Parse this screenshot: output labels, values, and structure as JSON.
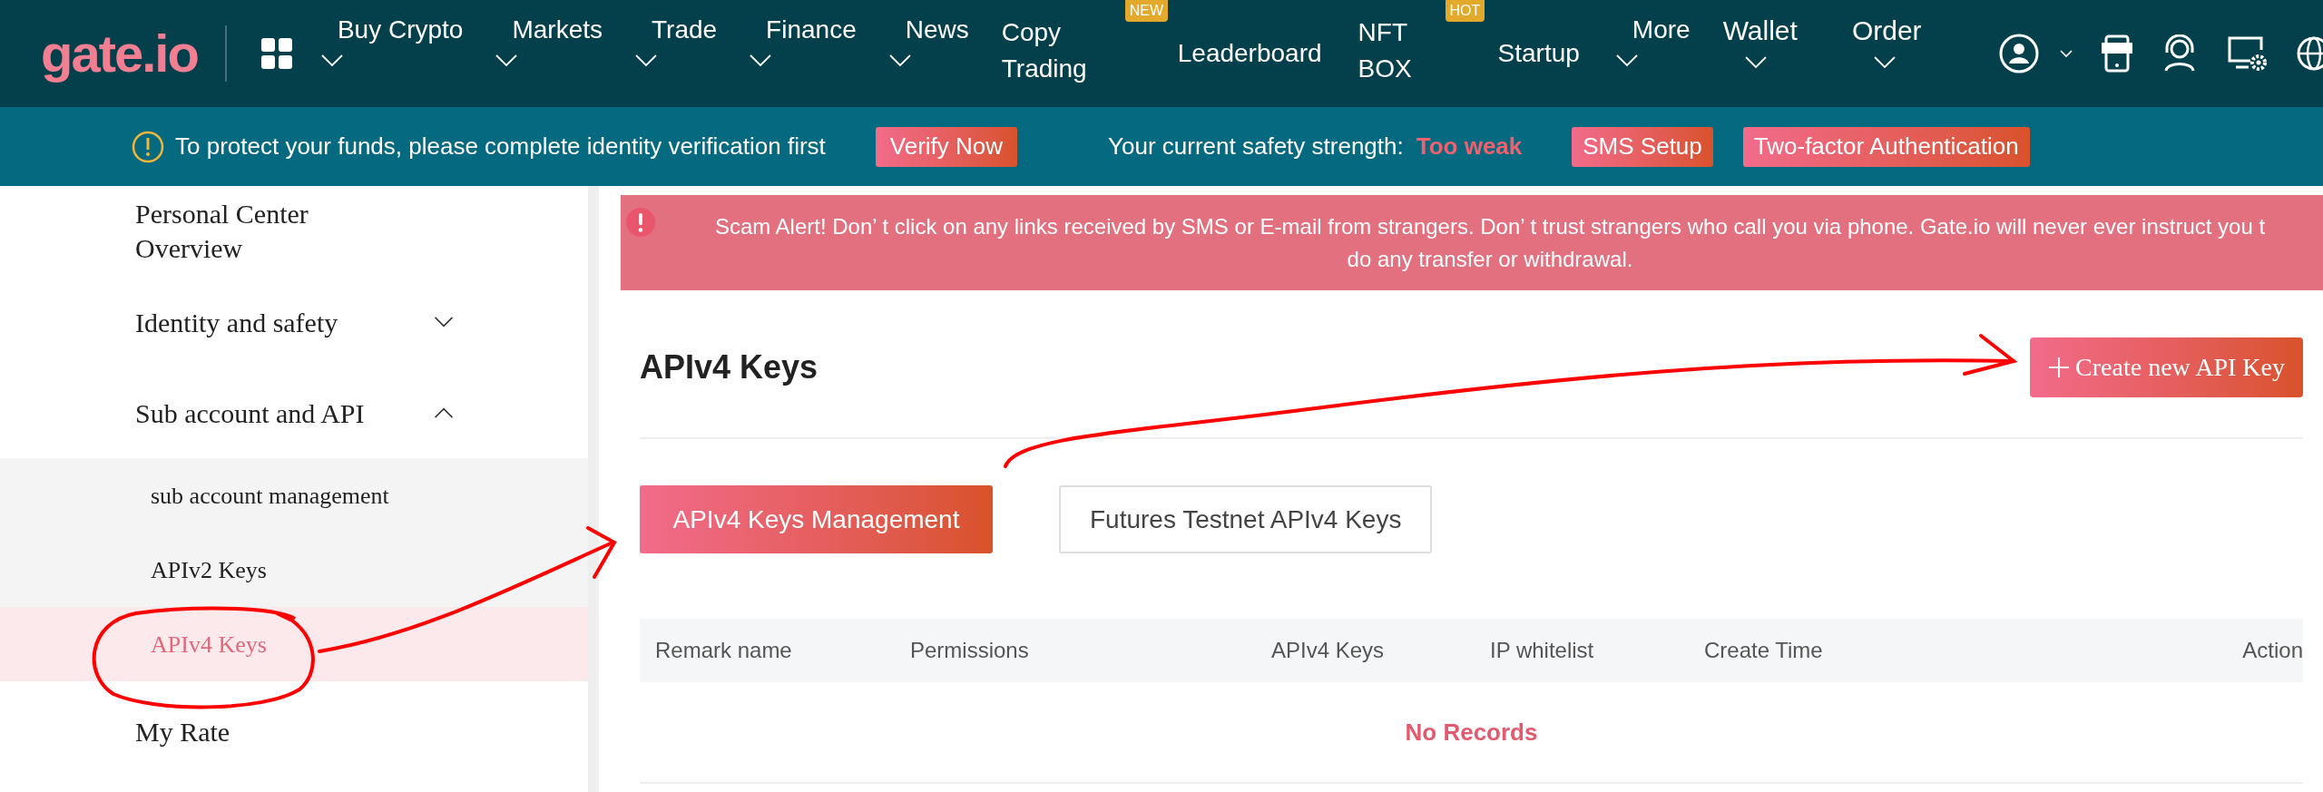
{
  "header": {
    "logo": "gate.io",
    "nav": [
      {
        "label": "Buy Crypto",
        "kind": "menu",
        "dropdown": true
      },
      {
        "label": "Markets",
        "kind": "menu",
        "dropdown": true
      },
      {
        "label": "Trade",
        "kind": "menu",
        "dropdown": true
      },
      {
        "label": "Finance",
        "kind": "menu",
        "dropdown": true
      },
      {
        "label": "News",
        "kind": "menu",
        "dropdown": true
      },
      {
        "label": "Copy Trading",
        "kind": "wrap",
        "dropdown": false,
        "badge": "NEW"
      },
      {
        "label": "Leaderboard",
        "kind": "center",
        "dropdown": false
      },
      {
        "label": "NFT BOX",
        "kind": "wrap",
        "dropdown": false,
        "badge": "HOT"
      },
      {
        "label": "Startup",
        "kind": "center",
        "dropdown": false
      },
      {
        "label": "More",
        "kind": "menu",
        "dropdown": true
      },
      {
        "label": "Wallet",
        "kind": "big",
        "dropdown": true
      },
      {
        "label": "Order",
        "kind": "big",
        "dropdown": true
      }
    ]
  },
  "notice": {
    "text": "To protect your funds, please complete identity verification first",
    "verify_button": "Verify Now",
    "strength_label": "Your current safety strength:",
    "strength_value": "Too weak",
    "buttons": [
      "SMS Setup",
      "Two-factor Authentication"
    ]
  },
  "sidebar": {
    "items": [
      {
        "label": "Personal Center Overview",
        "kind": "link"
      },
      {
        "label": "Identity and safety",
        "kind": "group",
        "expanded": false
      },
      {
        "label": "Sub account and API",
        "kind": "group",
        "expanded": true,
        "children": [
          {
            "label": "sub account management",
            "selected": false
          },
          {
            "label": "APIv2 Keys",
            "selected": false
          },
          {
            "label": "APIv4 Keys",
            "selected": true
          }
        ]
      },
      {
        "label": "My Rate",
        "kind": "link"
      }
    ]
  },
  "alert": {
    "lines": [
      "Scam Alert! Don’ t click on any links received by SMS or E-mail from strangers. Don’ t trust strangers who call you via phone. Gate.io will never ever instruct you t",
      "do any transfer or withdrawal."
    ]
  },
  "page": {
    "title": "APIv4 Keys",
    "create_button": "Create new API Key",
    "tabs": [
      {
        "label": "APIv4 Keys Management",
        "selected": true
      },
      {
        "label": "Futures Testnet APIv4 Keys",
        "selected": false
      }
    ],
    "table": {
      "columns": [
        "Remark name",
        "Permissions",
        "APIv4 Keys",
        "IP whitelist",
        "Create Time",
        "Action"
      ],
      "empty_text": "No Records"
    }
  }
}
